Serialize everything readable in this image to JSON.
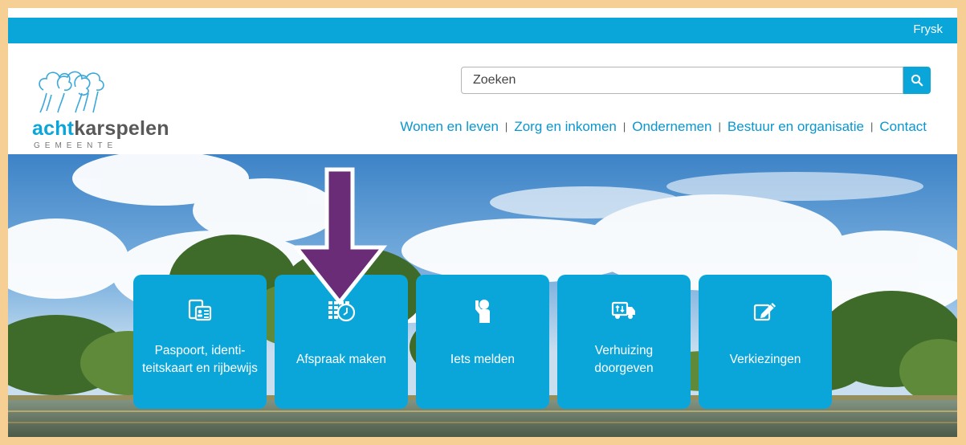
{
  "topbar": {
    "language_link": "Frysk"
  },
  "logo": {
    "word_accent": "acht",
    "word_main": "karspelen",
    "subtitle": "GEMEENTE"
  },
  "search": {
    "placeholder": "Zoeken"
  },
  "nav": {
    "items": [
      {
        "label": "Wonen en leven"
      },
      {
        "label": "Zorg en inkomen"
      },
      {
        "label": "Ondernemen"
      },
      {
        "label": "Bestuur en organisatie"
      },
      {
        "label": "Contact"
      }
    ],
    "separator": "|"
  },
  "tiles": [
    {
      "label": "Paspoort, identi-teitskaart en rijbewijs",
      "icon": "id-documents-icon"
    },
    {
      "label": "Afspraak maken",
      "icon": "calendar-clock-icon"
    },
    {
      "label": "Iets melden",
      "icon": "person-report-icon"
    },
    {
      "label": "Verhuizing doorgeven",
      "icon": "moving-truck-icon"
    },
    {
      "label": "Verkiezingen",
      "icon": "ballot-pencil-icon"
    }
  ],
  "annotation": {
    "arrow_color": "#6b2c77"
  },
  "colors": {
    "brand": "#0aa6d9",
    "frame": "#f5cf94"
  }
}
